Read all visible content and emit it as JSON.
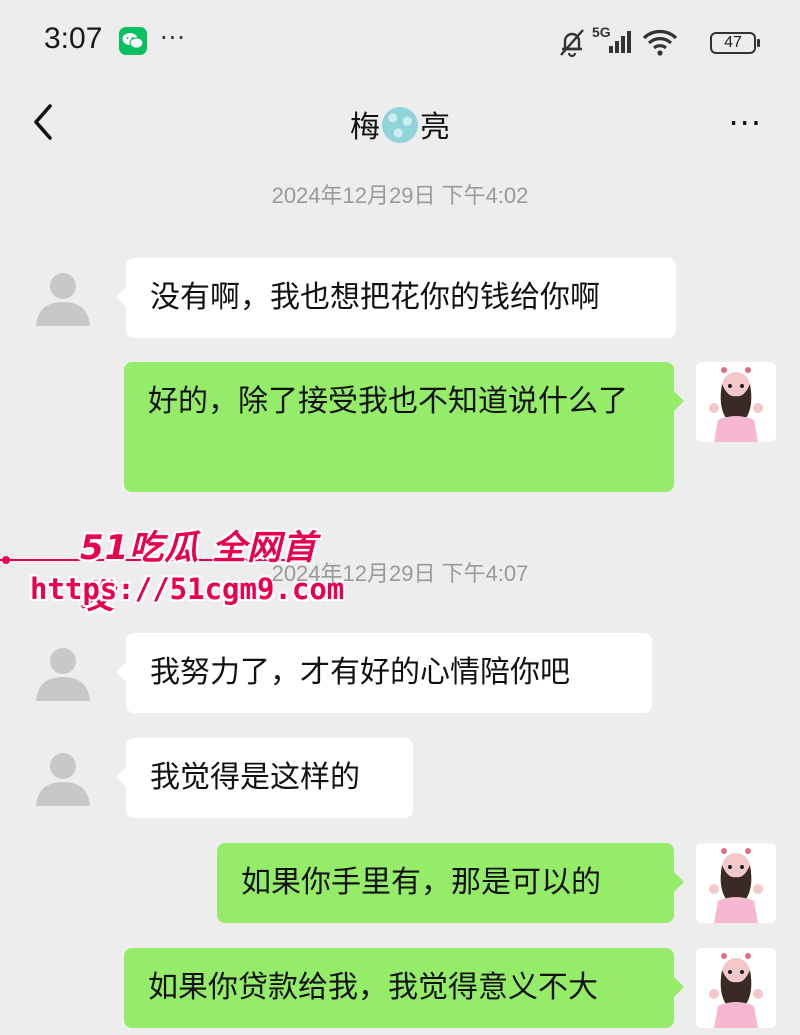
{
  "status_bar": {
    "time": "3:07",
    "dots": "···",
    "network": "5G",
    "battery": "47"
  },
  "header": {
    "title_left": "梅",
    "title_right": "亮",
    "more": "···"
  },
  "timestamps": [
    "2024年12月29日 下午4:02",
    "2024年12月29日 下午4:07"
  ],
  "messages": [
    {
      "side": "in",
      "text": "没有啊，我也想把花你的钱给你啊"
    },
    {
      "side": "out",
      "text": "好的，除了接受我也不知道说什么了"
    },
    {
      "side": "in",
      "text": "我努力了，才有好的心情陪你吧"
    },
    {
      "side": "in",
      "text": "我觉得是这样的"
    },
    {
      "side": "out",
      "text": "如果你手里有，那是可以的"
    },
    {
      "side": "out",
      "text": "如果你贷款给我，我觉得意义不大"
    }
  ],
  "watermark": {
    "logo": "51吃瓜 全网首发",
    "url": "https://51cgm9.com"
  },
  "colors": {
    "background": "#ededed",
    "bubble_in": "#ffffff",
    "bubble_out": "#95ec69",
    "wechat_green": "#07c160",
    "watermark": "#e8004f"
  }
}
